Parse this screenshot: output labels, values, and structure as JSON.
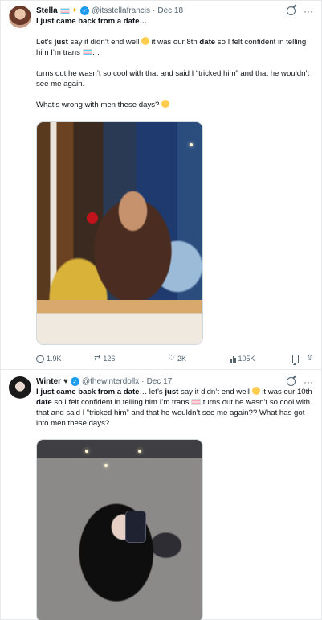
{
  "tweets": [
    {
      "author_name": "Stella",
      "handle": "@itsstellafrancis",
      "date": "Dec 18",
      "headline": "I just came back from a date…",
      "para1_a": "Let’s ",
      "para1_b": "just",
      "para1_c": " say it didn’t end well ",
      "para1_d": " it was our 8th ",
      "para1_e": "date",
      "para1_f": " so I felt confident in telling him I’m trans ",
      "para1_g": "…",
      "para2": "turns out he wasn’t so cool with that and said I “tricked him” and that he wouldn’t see me again.",
      "para3": "What’s wrong with men these days? ",
      "stats": {
        "replies": "1.9K",
        "reposts": "126",
        "likes": "2K",
        "views": "105K"
      }
    },
    {
      "author_name": "Winter",
      "handle": "@thewinterdollx",
      "date": "Dec 17",
      "t_a": "I just came back from a date",
      "t_b": "… let’s ",
      "t_c": "just",
      "t_d": " say it didn’t end well ",
      "t_e": " it was our 10th ",
      "t_f": "date",
      "t_g": " so I felt confident in telling him I’m trans ",
      "t_h": " turns out he wasn’t so cool with that and said I “tricked him” and that he wouldn’t see me again?? What has got into men these days?"
    }
  ],
  "separator_dot": "·",
  "icons": {
    "verified": "verified-badge-icon",
    "grok": "grok-icon",
    "more": "more-icon",
    "reply": "reply-icon",
    "repost": "repost-icon",
    "like": "heart-icon",
    "views": "views-icon",
    "bookmark": "bookmark-icon",
    "share": "share-icon"
  },
  "colors": {
    "accent": "#1d9bf0",
    "muted": "#536471",
    "text": "#0f1419"
  }
}
